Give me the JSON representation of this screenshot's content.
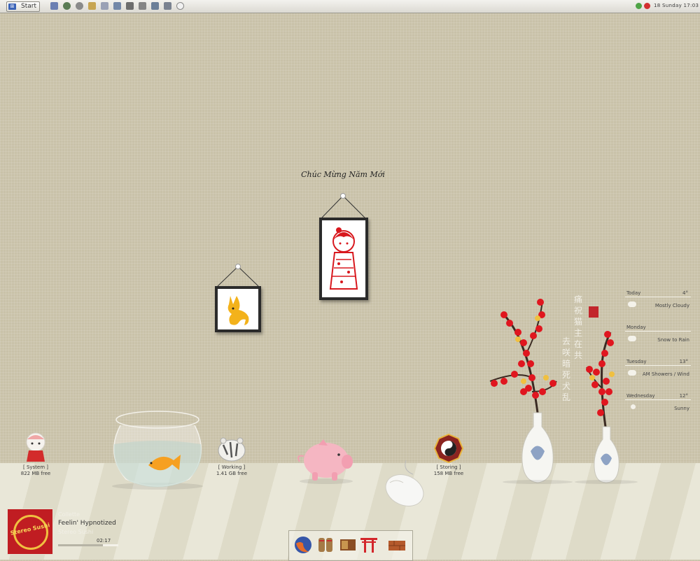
{
  "taskbar": {
    "start_label": "Start",
    "quick_launch": [
      "desktop-icon",
      "refresh-icon",
      "gear-icon",
      "home-icon",
      "document-icon",
      "folder-icon",
      "print-icon",
      "music-icon",
      "monitor-icon",
      "floppy-icon",
      "circle-icon"
    ],
    "tray": {
      "clock": "18 Sunday 17:03"
    }
  },
  "wall": {
    "greeting": "Chúc Mừng Năm Mới",
    "frames": [
      {
        "name": "dog-frame",
        "content": "dog-papercut-icon"
      },
      {
        "name": "girl-frame",
        "content": "kimono-girl-papercut-icon"
      }
    ],
    "poem": {
      "columns": [
        "痛祝猫主在共",
        "去咲暗死犬乱"
      ],
      "seal": "seal-stamp-icon"
    }
  },
  "drives": [
    {
      "label": "[ System ]",
      "free": "822 MB free",
      "icon": "lucky-doll-icon"
    },
    {
      "label": "[ Working ]",
      "free": "1.41 GB free",
      "icon": "tiger-toy-icon"
    },
    {
      "label": "[ Storing ]",
      "free": "158 MB free",
      "icon": "bagua-icon"
    }
  ],
  "decor": [
    "fishbowl-icon",
    "piggy-bank-icon",
    "computer-mouse-icon",
    "plum-blossom-vase-icon"
  ],
  "weather": [
    {
      "day": "Today",
      "temp": "4°",
      "condition": "Mostly Cloudy",
      "icon": "cloud-icon"
    },
    {
      "day": "Monday",
      "temp": "",
      "condition": "Snow to Rain",
      "icon": "snow-icon"
    },
    {
      "day": "Tuesday",
      "temp": "13°",
      "condition": "AM Showers / Wind",
      "icon": "rain-icon"
    },
    {
      "day": "Wednesday",
      "temp": "12°",
      "condition": "Sunny",
      "icon": "sun-icon"
    }
  ],
  "player": {
    "artist": "Collette",
    "track": "Feelin' Hypnotized",
    "album": "Stereo Sushi",
    "time": "02:17",
    "progress": 0.74,
    "cover_text": "Stereo Sushi"
  },
  "dock": [
    "firefox-icon",
    "sandals-icon",
    "brown-book-icon",
    "torii-gate-icon",
    "bricks-icon"
  ],
  "colors": {
    "wall": "#c9c2a9",
    "floor": "#e6e3d3",
    "blossom": "#e0161f",
    "accent": "#f0c040"
  }
}
